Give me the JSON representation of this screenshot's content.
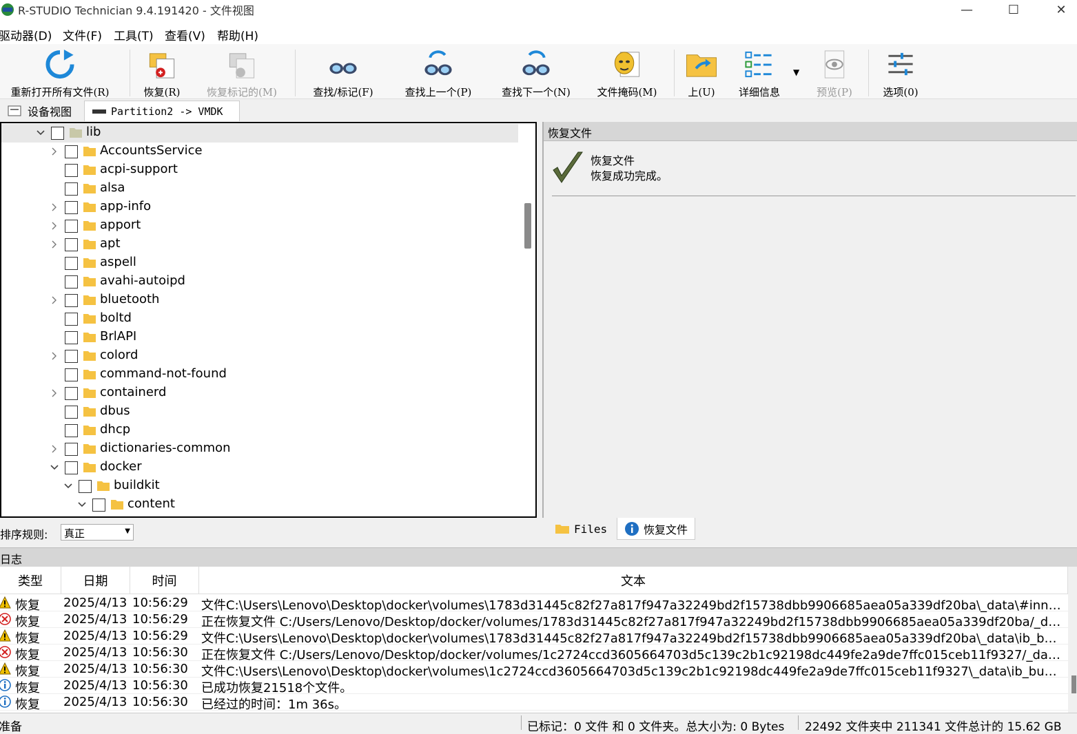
{
  "window": {
    "title": "R-STUDIO Technician 9.4.191420 - 文件视图"
  },
  "menu": [
    "驱动器(D)",
    "文件(F)",
    "工具(T)",
    "查看(V)",
    "帮助(H)"
  ],
  "toolbar": {
    "reopen": "重新打开所有文件(R)",
    "recover": "恢复(R)",
    "recover_marked": "恢复标记的(M)",
    "find_mark": "查找/标记(F)",
    "find_prev": "查找上一个(P)",
    "find_next": "查找下一个(N)",
    "file_mask": "文件掩码(M)",
    "up": "上(U)",
    "details": "详细信息",
    "preview": "预览(P)",
    "options": "选项(0)"
  },
  "tabs": {
    "device_view": "设备视图",
    "partition": "Partition2 -> VMDK"
  },
  "tree": {
    "items": [
      {
        "label": "lib",
        "level": 0,
        "expand": "open"
      },
      {
        "label": "AccountsService",
        "level": 1,
        "expand": "closed"
      },
      {
        "label": "acpi-support",
        "level": 1,
        "expand": "none"
      },
      {
        "label": "alsa",
        "level": 1,
        "expand": "none"
      },
      {
        "label": "app-info",
        "level": 1,
        "expand": "closed"
      },
      {
        "label": "apport",
        "level": 1,
        "expand": "closed"
      },
      {
        "label": "apt",
        "level": 1,
        "expand": "closed"
      },
      {
        "label": "aspell",
        "level": 1,
        "expand": "none"
      },
      {
        "label": "avahi-autoipd",
        "level": 1,
        "expand": "none"
      },
      {
        "label": "bluetooth",
        "level": 1,
        "expand": "closed"
      },
      {
        "label": "boltd",
        "level": 1,
        "expand": "none"
      },
      {
        "label": "BrlAPI",
        "level": 1,
        "expand": "none"
      },
      {
        "label": "colord",
        "level": 1,
        "expand": "closed"
      },
      {
        "label": "command-not-found",
        "level": 1,
        "expand": "none"
      },
      {
        "label": "containerd",
        "level": 1,
        "expand": "closed"
      },
      {
        "label": "dbus",
        "level": 1,
        "expand": "none"
      },
      {
        "label": "dhcp",
        "level": 1,
        "expand": "none"
      },
      {
        "label": "dictionaries-common",
        "level": 1,
        "expand": "closed"
      },
      {
        "label": "docker",
        "level": 1,
        "expand": "open"
      },
      {
        "label": "buildkit",
        "level": 2,
        "expand": "open"
      },
      {
        "label": "content",
        "level": 3,
        "expand": "open"
      }
    ]
  },
  "right_panel": {
    "header": "恢复文件",
    "line1": "恢复文件",
    "line2": "恢复成功完成。",
    "tab_files": "Files",
    "tab_recover": "恢复文件"
  },
  "sort": {
    "label": "排序规则:",
    "value": "真正"
  },
  "log": {
    "header": "日志",
    "columns": {
      "type": "类型",
      "date": "日期",
      "time": "时间",
      "text": "文本"
    },
    "rows": [
      {
        "icon": "warning",
        "type": "恢复",
        "date": "2025/4/13",
        "time": "10:56:29",
        "text": "文件C:\\Users\\Lenovo\\Desktop\\docker\\volumes\\1783d31445c82f27a817f947a32249bd2f15738dbb9906685aea05a339df20ba\\_data\\#innodb_t..."
      },
      {
        "icon": "error",
        "type": "恢复",
        "date": "2025/4/13",
        "time": "10:56:29",
        "text": "正在恢复文件 C:/Users/Lenovo/Desktop/docker/volumes/1783d31445c82f27a817f947a32249bd2f15738dbb9906685aea05a339df20ba/_data/i..."
      },
      {
        "icon": "warning",
        "type": "恢复",
        "date": "2025/4/13",
        "time": "10:56:29",
        "text": "文件C:\\Users\\Lenovo\\Desktop\\docker\\volumes\\1783d31445c82f27a817f947a32249bd2f15738dbb9906685aea05a339df20ba\\_data\\ib_buffer_..."
      },
      {
        "icon": "error",
        "type": "恢复",
        "date": "2025/4/13",
        "time": "10:56:30",
        "text": "正在恢复文件 C:/Users/Lenovo/Desktop/docker/volumes/1c2724ccd3605664703d5c139c2b1c92198dc449fe2a9de7ffc015ceb11f9327/_data/ib..."
      },
      {
        "icon": "warning",
        "type": "恢复",
        "date": "2025/4/13",
        "time": "10:56:30",
        "text": "文件C:\\Users\\Lenovo\\Desktop\\docker\\volumes\\1c2724ccd3605664703d5c139c2b1c92198dc449fe2a9de7ffc015ceb11f9327\\_data\\ib_buffer_p..."
      },
      {
        "icon": "info",
        "type": "恢复",
        "date": "2025/4/13",
        "time": "10:56:30",
        "text": "已成功恢复21518个文件。"
      },
      {
        "icon": "info",
        "type": "恢复",
        "date": "2025/4/13",
        "time": "10:56:30",
        "text": "已经过的时间：1m 36s。"
      }
    ]
  },
  "status": {
    "ready": "准备",
    "marked": "已标记：0 文件 和 0 文件夹。总大小为: 0 Bytes",
    "total": "22492 文件夹中 211341 文件总计的 15.62 GB"
  },
  "colors": {
    "folder": "#f5c242",
    "warning": "#f0c000",
    "error": "#d32020",
    "info": "#1f6fc2"
  }
}
